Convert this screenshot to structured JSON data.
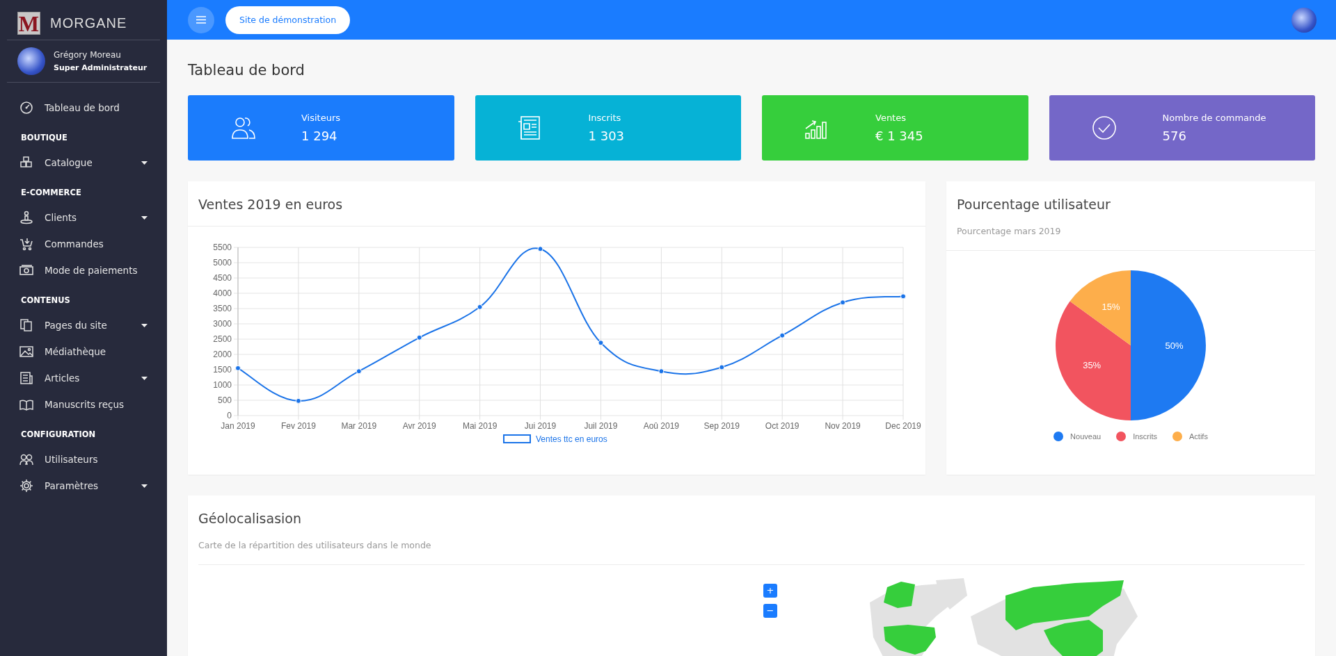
{
  "brand": {
    "logo_letter": "M",
    "name": "MORGANE"
  },
  "user": {
    "name": "Grégory Moreau",
    "role": "Super Administrateur"
  },
  "sidebar": {
    "items": [
      {
        "kind": "link",
        "label": "Tableau de bord",
        "has_submenu": false
      },
      {
        "kind": "section",
        "label": "BOUTIQUE"
      },
      {
        "kind": "link",
        "label": "Catalogue",
        "has_submenu": true
      },
      {
        "kind": "section",
        "label": "E-COMMERCE"
      },
      {
        "kind": "link",
        "label": "Clients",
        "has_submenu": true
      },
      {
        "kind": "link",
        "label": "Commandes",
        "has_submenu": false
      },
      {
        "kind": "link",
        "label": "Mode de paiements",
        "has_submenu": false
      },
      {
        "kind": "section",
        "label": "CONTENUS"
      },
      {
        "kind": "link",
        "label": "Pages du site",
        "has_submenu": true
      },
      {
        "kind": "link",
        "label": "Médiathèque",
        "has_submenu": false
      },
      {
        "kind": "link",
        "label": "Articles",
        "has_submenu": true
      },
      {
        "kind": "link",
        "label": "Manuscrits reçus",
        "has_submenu": false
      },
      {
        "kind": "section",
        "label": "CONFIGURATION"
      },
      {
        "kind": "link",
        "label": "Utilisateurs",
        "has_submenu": false
      },
      {
        "kind": "link",
        "label": "Paramètres",
        "has_submenu": true
      }
    ]
  },
  "topbar": {
    "site_button": "Site de démonstration"
  },
  "page_title": "Tableau de bord",
  "stats": [
    {
      "label": "Visiteurs",
      "value": "1 294",
      "color": "#1b7cfc"
    },
    {
      "label": "Inscrits",
      "value": "1 303",
      "color": "#06b2d6"
    },
    {
      "label": "Ventes",
      "value": "€ 1 345",
      "color": "#36ce3c"
    },
    {
      "label": "Nombre de commande",
      "value": "576",
      "color": "#7467c8"
    }
  ],
  "sales_card": {
    "title": "Ventes 2019 en euros",
    "chart_data": {
      "type": "line",
      "categories": [
        "Jan 2019",
        "Fev 2019",
        "Mar 2019",
        "Avr 2019",
        "Mai 2019",
        "Jui 2019",
        "Juil 2019",
        "Aoû 2019",
        "Sep 2019",
        "Oct 2019",
        "Nov 2019",
        "Dec 2019"
      ],
      "grid": true,
      "legend": true,
      "series": [
        {
          "name": "Ventes ttc en euros",
          "color": "#1a73e8",
          "marker": "circle",
          "values": [
            1550,
            480,
            1450,
            2550,
            3550,
            5450,
            2380,
            1450,
            1580,
            2620,
            3700,
            3900
          ]
        }
      ],
      "ylim": [
        0,
        5500
      ],
      "yticks": [
        0,
        500,
        1000,
        1500,
        2000,
        2500,
        3000,
        3500,
        4000,
        4500,
        5000,
        5500
      ]
    }
  },
  "users_card": {
    "title": "Pourcentage utilisateur",
    "subtitle": "Pourcentage mars 2019",
    "chart_data": {
      "type": "pie",
      "categories": [
        "Nouveau",
        "Inscrits",
        "Actifs"
      ],
      "values": [
        50,
        35,
        15
      ],
      "value_labels": [
        "50%",
        "35%",
        "15%"
      ],
      "legend": {
        "entries": [
          {
            "color": "#1e7af2"
          },
          {
            "color": "#f2545f"
          },
          {
            "color": "#fdae4b"
          }
        ]
      }
    }
  },
  "geo_card": {
    "title": "Géolocalisasion",
    "subtitle": "Carte de la répartition des utilisateurs dans le monde",
    "zoom_in": "+",
    "zoom_out": "−"
  }
}
